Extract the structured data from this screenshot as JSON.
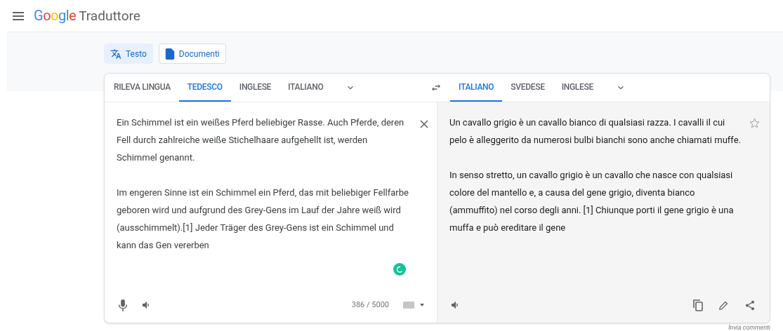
{
  "header": {
    "logo": "Google",
    "title": "Traduttore"
  },
  "modes": [
    {
      "label": "Testo",
      "kind": "text",
      "selected": true
    },
    {
      "label": "Documenti",
      "kind": "docs",
      "selected": false
    }
  ],
  "source_languages": [
    {
      "label": "RILEVA LINGUA",
      "selected": false
    },
    {
      "label": "TEDESCO",
      "selected": true
    },
    {
      "label": "INGLESE",
      "selected": false
    },
    {
      "label": "ITALIANO",
      "selected": false
    }
  ],
  "target_languages": [
    {
      "label": "ITALIANO",
      "selected": true
    },
    {
      "label": "SVEDESE",
      "selected": false
    },
    {
      "label": "INGLESE",
      "selected": false
    }
  ],
  "source_text": [
    "Ein Schimmel ist ein weißes Pferd beliebiger Rasse. Auch Pferde, deren Fell durch zahlreiche weiße Stichelhaare aufgehellt ist, werden Schimmel genannt.",
    "Im engeren Sinne ist ein Schimmel ein Pferd, das mit beliebiger Fellfarbe geboren wird und aufgrund des Grey-Gens im Lauf der Jahre weiß wird (ausschimmelt).[1] Jeder Träger des Grey-Gens ist ein Schimmel und kann das Gen vererben"
  ],
  "char_count": "386 / 5000",
  "translation": [
    "Un cavallo grigio è un cavallo bianco di qualsiasi razza. I cavalli il cui pelo è alleggerito da numerosi bulbi bianchi sono anche chiamati muffe.",
    "In senso stretto, un cavallo grigio è un cavallo che nasce con qualsiasi colore del mantello e, a causa del gene grigio, diventa bianco (ammuffito) nel corso degli anni. [1] Chiunque porti il gene grigio è una muffa e può ereditare il gene"
  ],
  "feedback_link": "Invia commenti"
}
